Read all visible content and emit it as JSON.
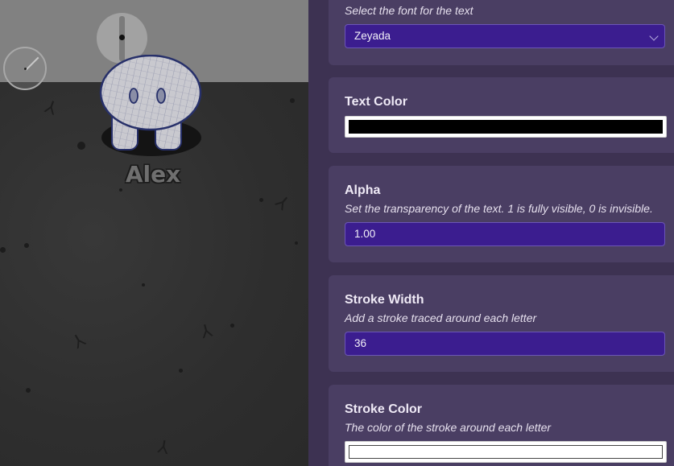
{
  "game": {
    "character_name": "Alex"
  },
  "panel": {
    "font": {
      "description": "Select the font for the text",
      "value": "Zeyada",
      "icon": "chevron-down-icon"
    },
    "text_color": {
      "title": "Text Color",
      "color": "#000000"
    },
    "alpha": {
      "title": "Alpha",
      "description": "Set the transparency of the text. 1 is fully visible, 0 is invisible.",
      "value": "1.00"
    },
    "stroke_width": {
      "title": "Stroke Width",
      "description": "Add a stroke traced around each letter",
      "value": "36"
    },
    "stroke_color": {
      "title": "Stroke Color",
      "description": "The color of the stroke around each letter",
      "color": "#ffffff"
    }
  },
  "colors": {
    "panel_bg": "#3d3252",
    "card_bg": "#4a3e63",
    "input_bg": "#3b1d8f",
    "input_border": "#6c56b6"
  }
}
